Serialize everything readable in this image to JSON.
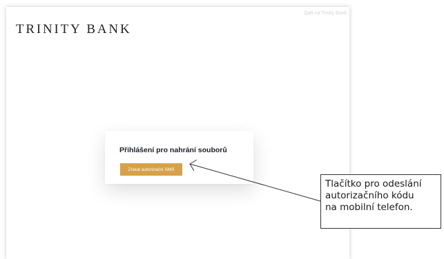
{
  "header": {
    "back_link": "Zpět na Trinity Bank",
    "brand": "TRINITY BANK"
  },
  "login_card": {
    "title": "Přihlášení pro nahrání souborů",
    "button_label": "Získat autorizační SMS"
  },
  "annotation": {
    "lines": [
      "Tlačítko pro odeslání",
      "autorizačního kódu",
      "na mobilní telefon."
    ]
  },
  "colors": {
    "accent": "#d7a04a",
    "brand_text": "#242424",
    "back_link": "#d4d4d4"
  }
}
